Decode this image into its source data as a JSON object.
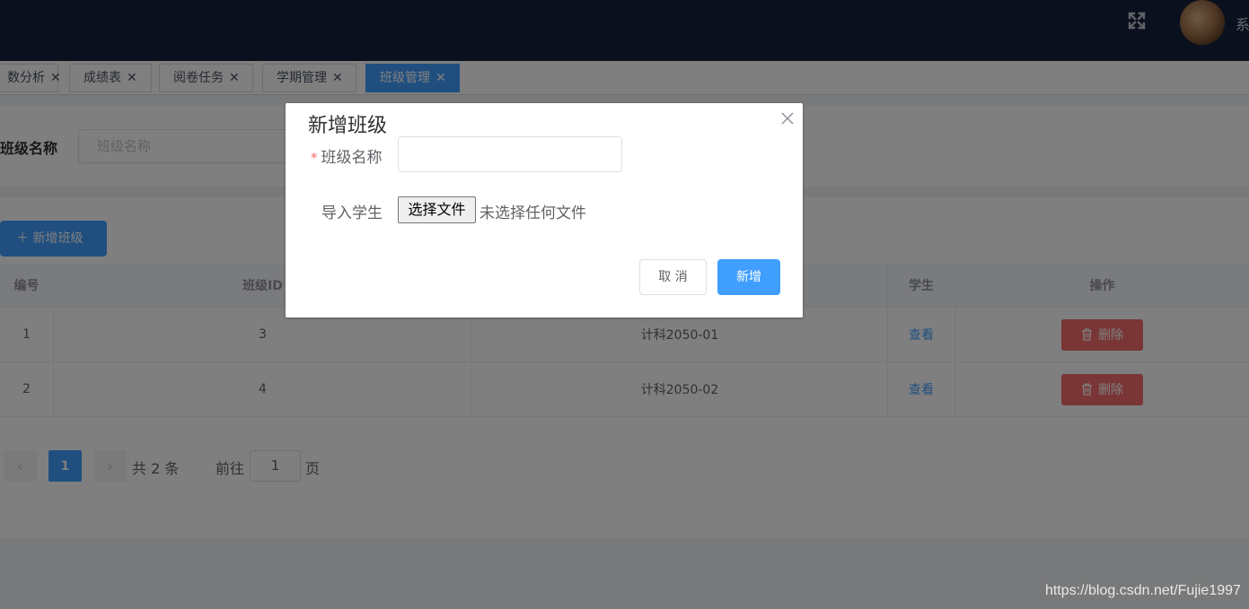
{
  "header": {
    "username": "系"
  },
  "tags": [
    {
      "label": "数分析",
      "active": false
    },
    {
      "label": "成绩表",
      "active": false
    },
    {
      "label": "阅卷任务",
      "active": false
    },
    {
      "label": "学期管理",
      "active": false
    },
    {
      "label": "班级管理",
      "active": true
    }
  ],
  "tag_close_glyph": "✕",
  "filter": {
    "label": "班级名称",
    "placeholder": "班级名称"
  },
  "toolbar": {
    "add_label": "＋ 新增班级"
  },
  "table": {
    "headers": [
      "编号",
      "班级ID",
      "",
      "学生",
      "操作"
    ],
    "rows": [
      {
        "index": "1",
        "id": "3",
        "name": "计科2050-01",
        "view": "查看",
        "delete": "删除"
      },
      {
        "index": "2",
        "id": "4",
        "name": "计科2050-02",
        "view": "查看",
        "delete": "删除"
      }
    ]
  },
  "pagination": {
    "prev": "‹",
    "current": "1",
    "next": "›",
    "total": "共 2 条",
    "goto_prefix": "前往",
    "goto_value": "1",
    "goto_suffix": "页"
  },
  "dialog": {
    "title": "新增班级",
    "required_mark": "*",
    "name_label": "班级名称",
    "import_label": "导入学生",
    "file_button": "选择文件",
    "file_status": "未选择任何文件",
    "cancel_label": "取 消",
    "confirm_label": "新增"
  },
  "watermark": "https://blog.csdn.net/Fujie1997",
  "colors": {
    "header_bg": "#14213a",
    "primary": "#409eff",
    "danger": "#f56c6c"
  }
}
